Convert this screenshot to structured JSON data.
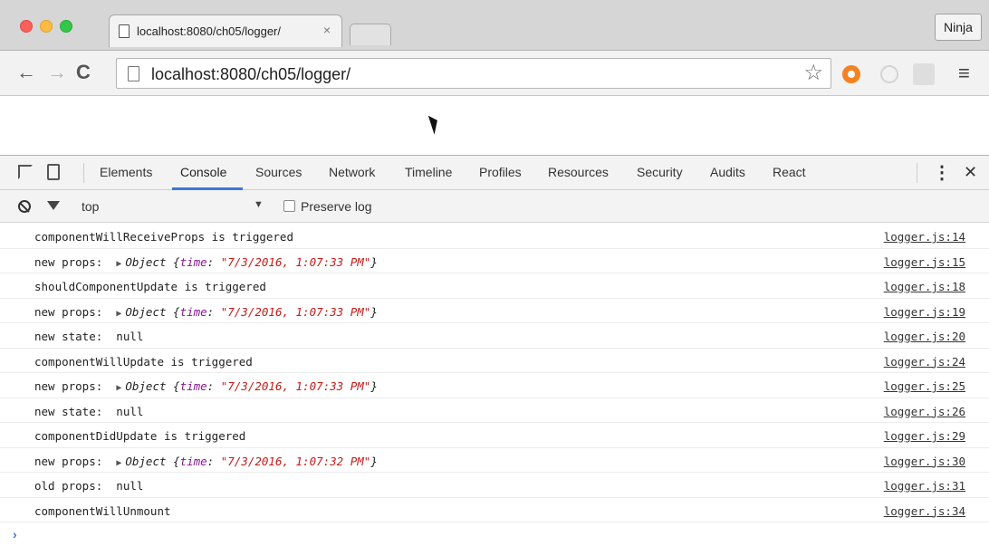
{
  "browser": {
    "tab_title": "localhost:8080/ch05/logger/",
    "tab_close": "×",
    "profile_label": "Ninja",
    "url": "localhost:8080/ch05/logger/",
    "back_icon": "←",
    "forward_icon": "→",
    "reload_icon": "C",
    "star_icon": "☆",
    "menu_icon": "≡"
  },
  "devtools": {
    "tabs": [
      "Elements",
      "Console",
      "Sources",
      "Network",
      "Timeline",
      "Profiles",
      "Resources",
      "Security",
      "Audits",
      "React"
    ],
    "active_tab": "Console",
    "more_icon": "⋮",
    "close_icon": "✕",
    "filter": {
      "context": "top",
      "dropdown_arrow": "▼",
      "preserve_log_label": "Preserve log",
      "preserve_log_checked": false
    }
  },
  "console": {
    "rows": [
      {
        "text": "componentWillReceiveProps is triggered",
        "source": "logger.js:14"
      },
      {
        "prefix": "new props:  ",
        "object": {
          "kw": "Object",
          "key": "time",
          "value": "\"7/3/2016, 1:07:33 PM\""
        },
        "source": "logger.js:15"
      },
      {
        "text": "shouldComponentUpdate is triggered",
        "source": "logger.js:18"
      },
      {
        "prefix": "new props:  ",
        "object": {
          "kw": "Object",
          "key": "time",
          "value": "\"7/3/2016, 1:07:33 PM\""
        },
        "source": "logger.js:19"
      },
      {
        "text": "new state:  null",
        "source": "logger.js:20"
      },
      {
        "text": "componentWillUpdate is triggered",
        "source": "logger.js:24"
      },
      {
        "prefix": "new props:  ",
        "object": {
          "kw": "Object",
          "key": "time",
          "value": "\"7/3/2016, 1:07:33 PM\""
        },
        "source": "logger.js:25"
      },
      {
        "text": "new state:  null",
        "source": "logger.js:26"
      },
      {
        "text": "componentDidUpdate is triggered",
        "source": "logger.js:29"
      },
      {
        "prefix": "new props:  ",
        "object": {
          "kw": "Object",
          "key": "time",
          "value": "\"7/3/2016, 1:07:32 PM\""
        },
        "source": "logger.js:30"
      },
      {
        "text": "old props:  null",
        "source": "logger.js:31"
      },
      {
        "text": "componentWillUnmount",
        "source": "logger.js:34"
      }
    ],
    "prompt": "›"
  }
}
